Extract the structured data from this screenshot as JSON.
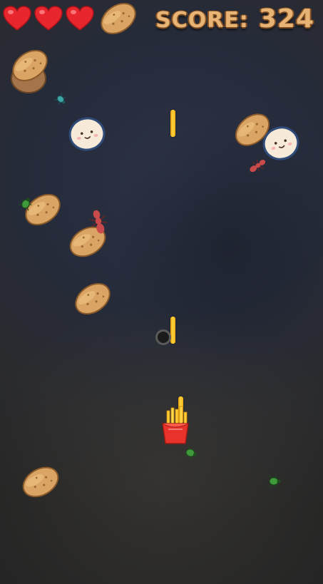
{
  "hud": {
    "lives": 3,
    "lives_icon": "heart-icon",
    "score_label": "SCORE:",
    "score_value": "324"
  },
  "colors": {
    "heart": "#e8262e",
    "score_text": "#e8b476",
    "potato": "#d9a464",
    "fry": "#ffcc33",
    "fry_box": "#e8322a"
  },
  "entities": {
    "potatoes": 7,
    "egg_faces": 2,
    "bugs": [
      "teal-beetle-icon",
      "red-ant-icon",
      "green-beetle-icon",
      "red-ant-icon",
      "green-beetle-icon",
      "green-beetle-icon"
    ],
    "fry_projectiles": 3,
    "player": "fries-box-icon"
  }
}
